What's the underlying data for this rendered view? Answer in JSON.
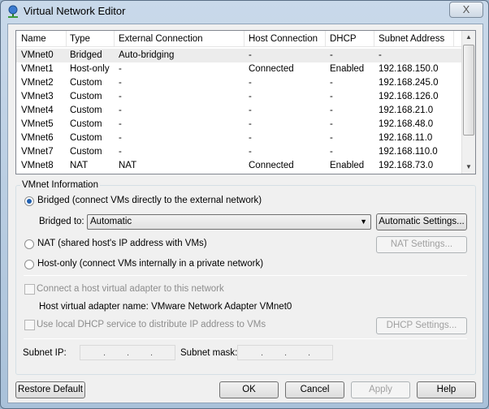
{
  "window": {
    "title": "Virtual Network Editor",
    "close_label": "X"
  },
  "table": {
    "columns": [
      "Name",
      "Type",
      "External Connection",
      "Host Connection",
      "DHCP",
      "Subnet Address"
    ],
    "rows": [
      [
        "VMnet0",
        "Bridged",
        "Auto-bridging",
        "-",
        "-",
        "-"
      ],
      [
        "VMnet1",
        "Host-only",
        "-",
        "Connected",
        "Enabled",
        "192.168.150.0"
      ],
      [
        "VMnet2",
        "Custom",
        "-",
        "-",
        "-",
        "192.168.245.0"
      ],
      [
        "VMnet3",
        "Custom",
        "-",
        "-",
        "-",
        "192.168.126.0"
      ],
      [
        "VMnet4",
        "Custom",
        "-",
        "-",
        "-",
        "192.168.21.0"
      ],
      [
        "VMnet5",
        "Custom",
        "-",
        "-",
        "-",
        "192.168.48.0"
      ],
      [
        "VMnet6",
        "Custom",
        "-",
        "-",
        "-",
        "192.168.11.0"
      ],
      [
        "VMnet7",
        "Custom",
        "-",
        "-",
        "-",
        "192.168.110.0"
      ],
      [
        "VMnet8",
        "NAT",
        "NAT",
        "Connected",
        "Enabled",
        "192.168.73.0"
      ]
    ]
  },
  "info": {
    "group_label": "VMnet Information",
    "bridged_label": "Bridged (connect VMs directly to the external network)",
    "bridged_to_label": "Bridged to:",
    "bridged_to_value": "Automatic",
    "auto_settings": "Automatic Settings...",
    "nat_label": "NAT (shared host's IP address with VMs)",
    "nat_settings": "NAT Settings...",
    "hostonly_label": "Host-only (connect VMs internally in a private network)",
    "connect_adapter_label": "Connect a host virtual adapter to this network",
    "adapter_name": "Host virtual adapter name: VMware Network Adapter VMnet0",
    "dhcp_label": "Use local DHCP service to distribute IP address to VMs",
    "dhcp_settings": "DHCP Settings...",
    "subnet_ip_label": "Subnet IP:",
    "subnet_mask_label": "Subnet mask:",
    "dot": "."
  },
  "buttons": {
    "restore": "Restore Default",
    "ok": "OK",
    "cancel": "Cancel",
    "apply": "Apply",
    "help": "Help"
  }
}
